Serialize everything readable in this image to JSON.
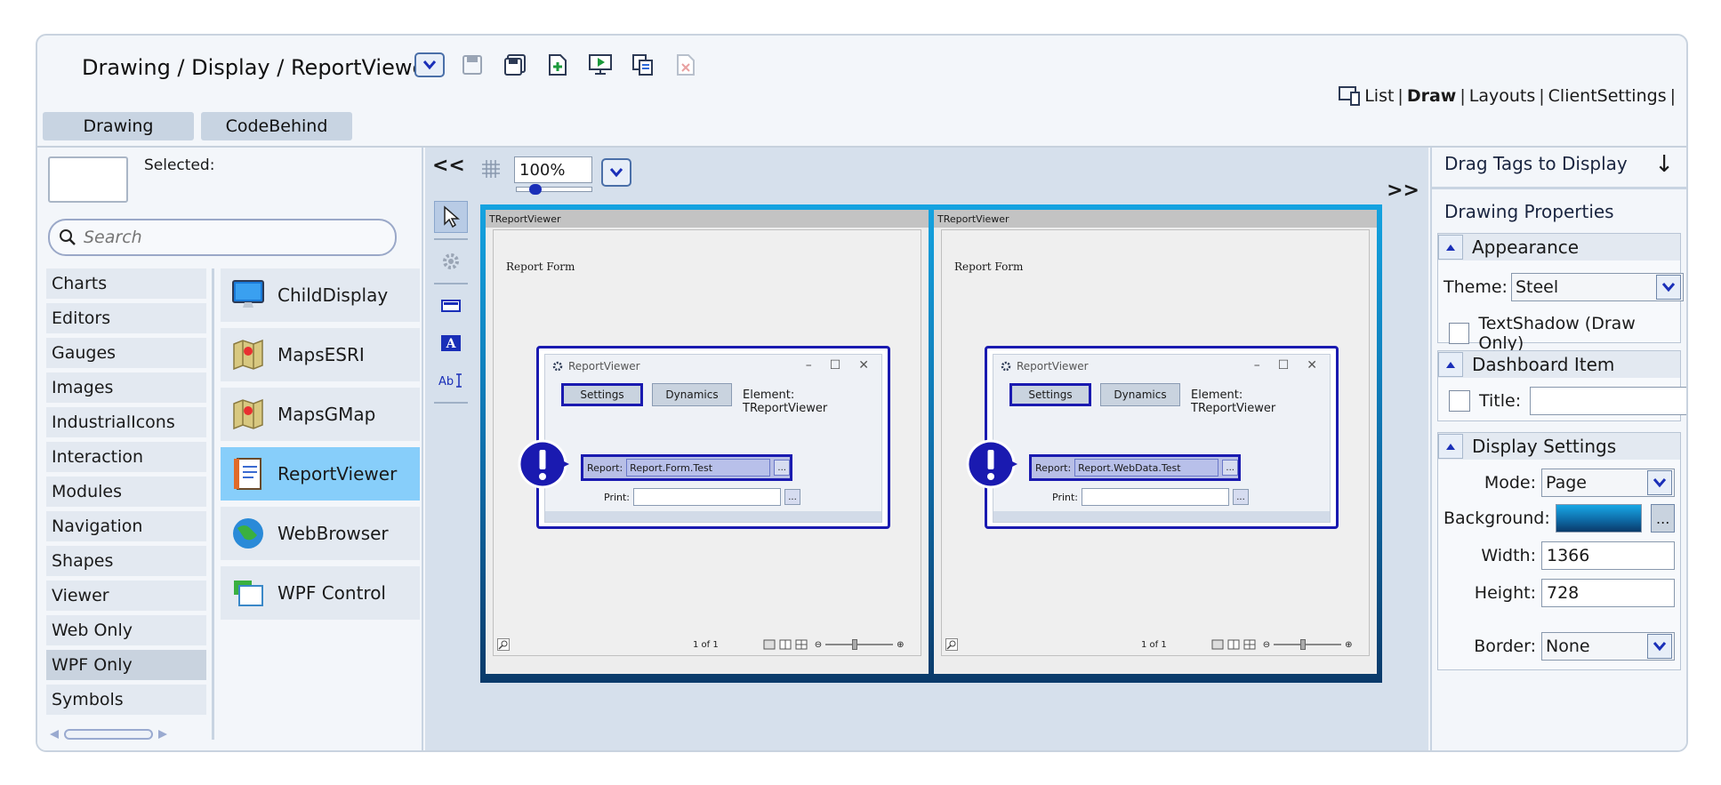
{
  "header": {
    "breadcrumb": "Drawing / Display / ReportViewer",
    "nav": {
      "list": "List",
      "sep": "|",
      "draw": "Draw",
      "layouts": "Layouts",
      "client": "ClientSettings"
    }
  },
  "tabs": [
    {
      "label": "Drawing"
    },
    {
      "label": "CodeBehind"
    }
  ],
  "left": {
    "selected_label": "Selected:",
    "search_placeholder": "Search",
    "categories": [
      "Charts",
      "Editors",
      "Gauges",
      "Images",
      "IndustrialIcons",
      "Interaction",
      "Modules",
      "Navigation",
      "Shapes",
      "Viewer",
      "Web Only",
      "WPF Only",
      "Symbols"
    ],
    "selected_category": "WPF Only",
    "items": [
      {
        "label": "ChildDisplay",
        "icon": "monitor-icon"
      },
      {
        "label": "MapsESRI",
        "icon": "map-icon"
      },
      {
        "label": "MapsGMap",
        "icon": "map-icon"
      },
      {
        "label": "ReportViewer",
        "icon": "report-icon"
      },
      {
        "label": "WebBrowser",
        "icon": "globe-icon"
      },
      {
        "label": "WPF Control",
        "icon": "window-icon"
      }
    ],
    "selected_item": "ReportViewer"
  },
  "center": {
    "collapse_left": "<<",
    "expand_right": ">>",
    "zoom": "100%",
    "zoom_level": 0.2,
    "viewers": [
      {
        "title": "TReportViewer",
        "form": "Report Form",
        "dialog_title": "ReportViewer",
        "settings": "Settings",
        "dynamics": "Dynamics",
        "element": "Element: TReportViewer",
        "report_label": "Report:",
        "report_value": "Report.Form.Test",
        "print_label": "Print:",
        "dots": "...",
        "pager": "1 of 1"
      },
      {
        "title": "TReportViewer",
        "form": "Report Form",
        "dialog_title": "ReportViewer",
        "settings": "Settings",
        "dynamics": "Dynamics",
        "element": "Element: TReportViewer",
        "report_label": "Report:",
        "report_value": "Report.WebData.Test",
        "print_label": "Print:",
        "dots": "...",
        "pager": "1 of 1"
      }
    ],
    "canvas_gradient": [
      "#14a3e0",
      "#0e6ca8",
      "#0a3a6a"
    ]
  },
  "right": {
    "drag_tags": "Drag Tags to Display",
    "drag_arrow": "↓",
    "props_title": "Drawing Properties",
    "appearance": {
      "title": "Appearance",
      "theme_label": "Theme:",
      "theme_value": "Steel",
      "textshadow_label": "TextShadow (Draw Only)"
    },
    "dashboard": {
      "title": "Dashboard Item",
      "title_label": "Title:",
      "title_value": ""
    },
    "display": {
      "title": "Display Settings",
      "mode_label": "Mode:",
      "mode_value": "Page",
      "background_label": "Background:",
      "background_dots": "...",
      "width_label": "Width:",
      "width_value": "1366",
      "height_label": "Height:",
      "height_value": "728",
      "border_label": "Border:",
      "border_value": "None"
    }
  },
  "colors": {
    "accent": "#1a1ab0",
    "selected_item": "#87cefa",
    "panel": "#f3f6fa"
  }
}
